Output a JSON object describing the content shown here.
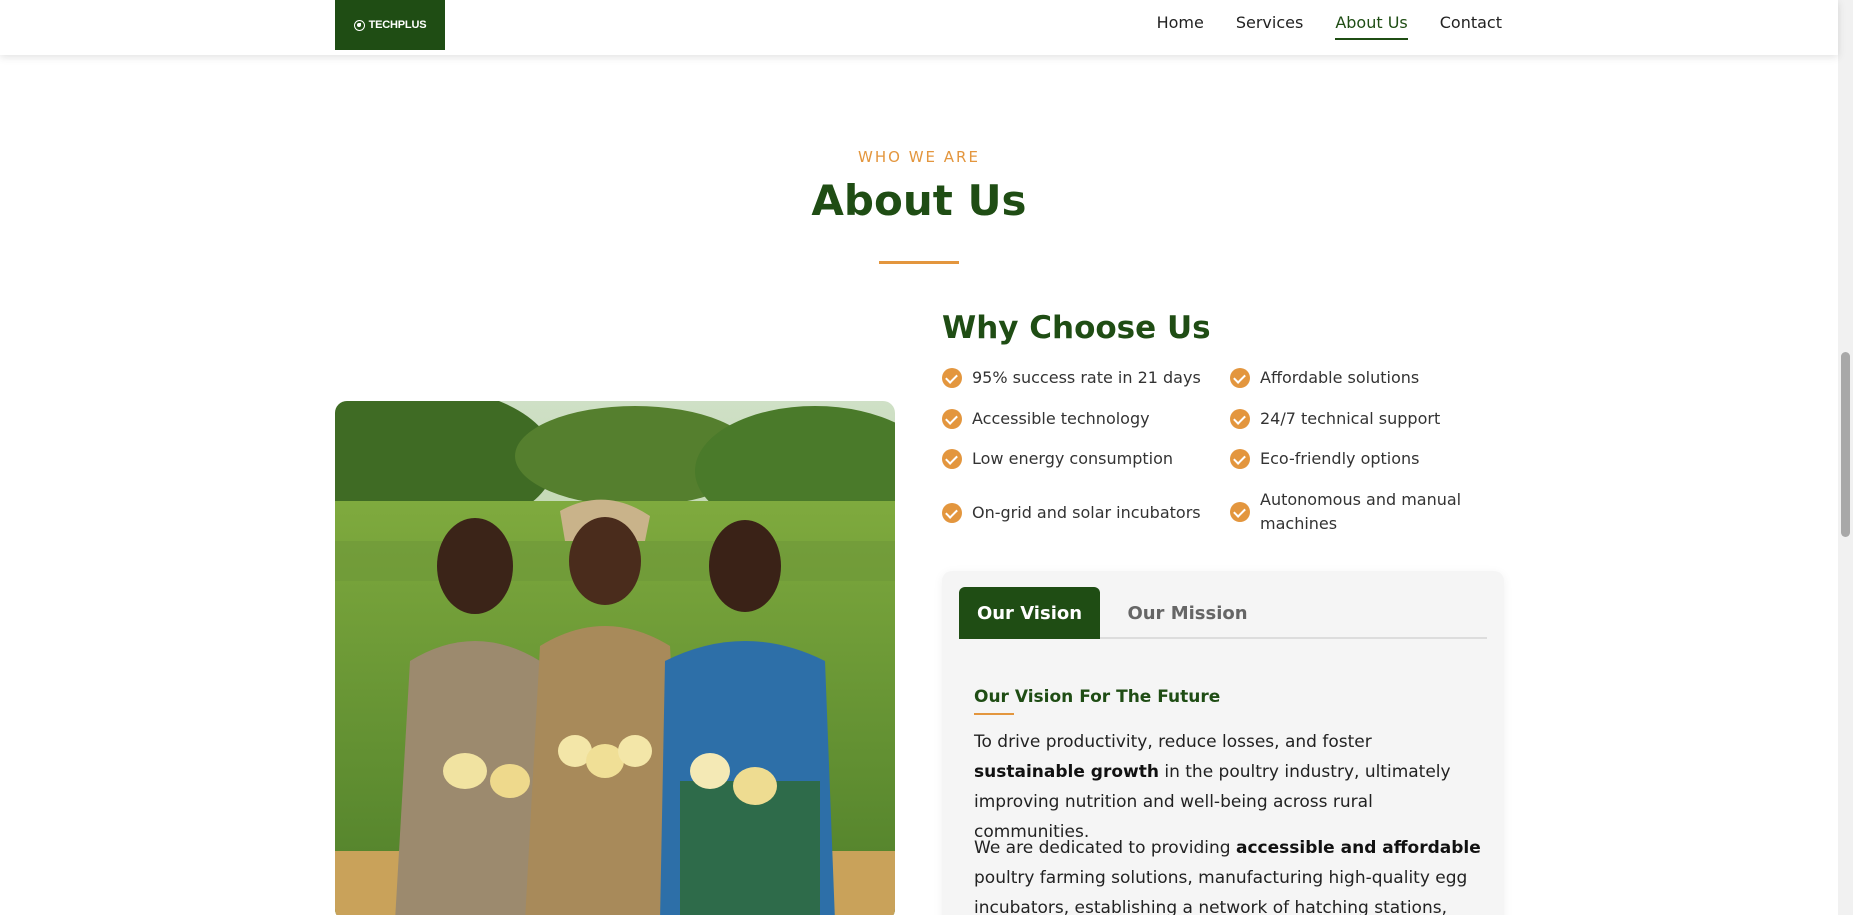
{
  "header": {
    "logo_text": "TECHPLUS",
    "nav": [
      {
        "label": "Home"
      },
      {
        "label": "Services"
      },
      {
        "label": "About Us",
        "active": true
      },
      {
        "label": "Contact"
      }
    ]
  },
  "about": {
    "eyebrow": "WHO WE ARE",
    "title": "About Us"
  },
  "why": {
    "title": "Why Choose Us",
    "features": [
      "95% success rate in 21 days",
      "Affordable solutions",
      "Accessible technology",
      "24/7 technical support",
      "Low energy consumption",
      "Eco-friendly options",
      "On-grid and solar incubators",
      "Autonomous and manual machines"
    ]
  },
  "tabs": {
    "vision_label": "Our Vision",
    "mission_label": "Our Mission",
    "active": "Our Vision"
  },
  "vision": {
    "heading": "Our Vision For The Future",
    "p1_before": "To drive productivity, reduce losses, and foster ",
    "p1_bold": "sustainable growth",
    "p1_after": " in the poultry industry, ultimately improving nutrition and well-being across rural communities.",
    "p2_before": "We are dedicated to providing ",
    "p2_bold": "accessible and affordable",
    "p2_after": " poultry farming solutions, manufacturing high-quality egg incubators, establishing a network of hatching stations,"
  },
  "colors": {
    "primary_green": "#1f4d14",
    "accent_orange": "#e3963e"
  },
  "icons": [
    "check-circle-icon",
    "logo-leaf-icon"
  ]
}
